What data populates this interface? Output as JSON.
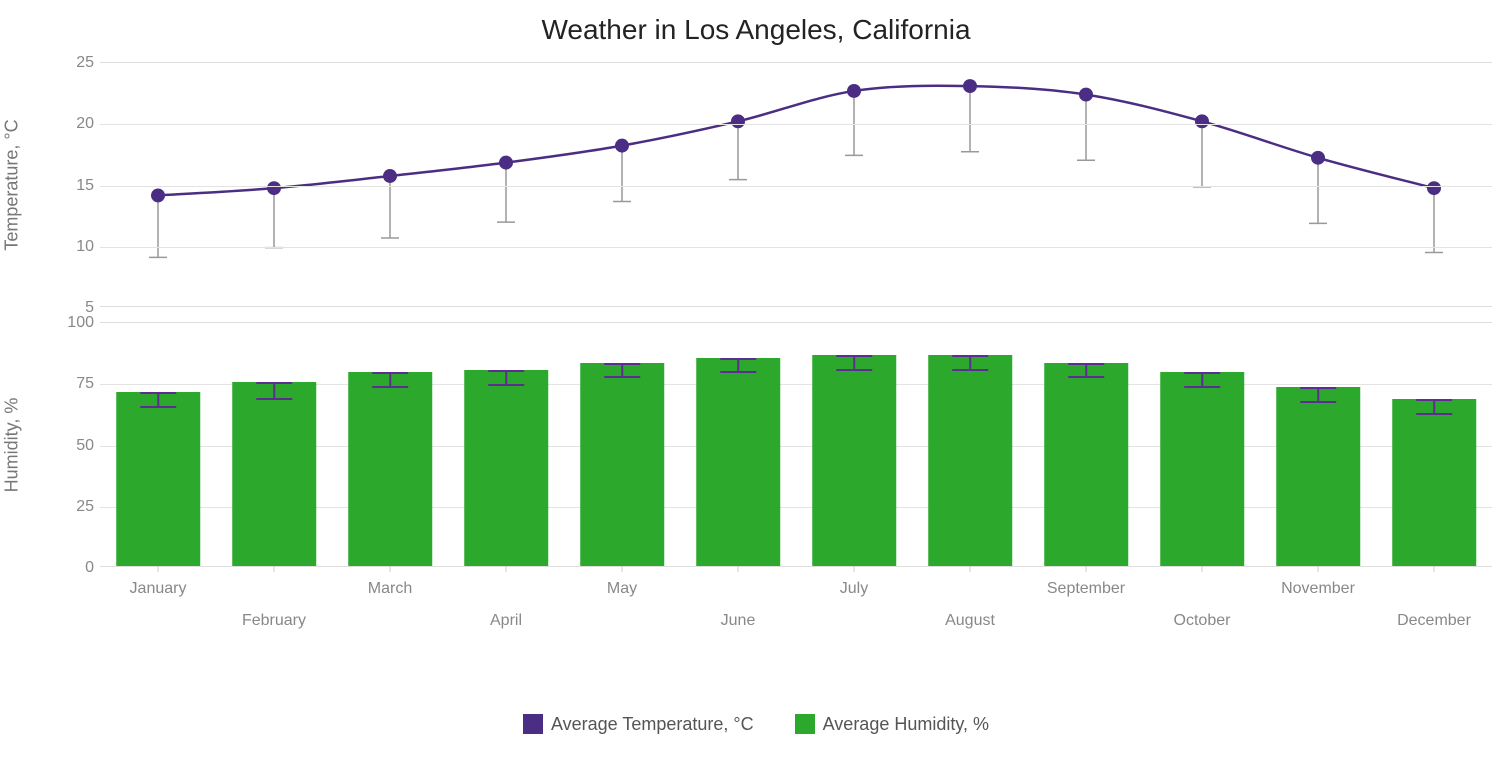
{
  "title": "Weather in Los Angeles, California",
  "legend": {
    "temp": "Average Temperature, °C",
    "humid": "Average Humidity, %"
  },
  "axes": {
    "temp": {
      "label": "Temperature, °C",
      "min": 5,
      "max": 25,
      "ticks": [
        5,
        10,
        15,
        20,
        25
      ]
    },
    "humid": {
      "label": "Humidity, %",
      "min": 0,
      "max": 100,
      "ticks": [
        0,
        25,
        50,
        75,
        100
      ]
    }
  },
  "categories": [
    "January",
    "February",
    "March",
    "April",
    "May",
    "June",
    "July",
    "August",
    "September",
    "October",
    "November",
    "December"
  ],
  "colors": {
    "temp": "#4b2e83",
    "humid": "#2ca92c",
    "humid_err": "#5e2d91",
    "temp_err": "#999999"
  },
  "chart_data": [
    {
      "type": "line",
      "name": "Average Temperature, °C",
      "ylabel": "Temperature, °C",
      "ylim": [
        5,
        25
      ],
      "categories": [
        "January",
        "February",
        "March",
        "April",
        "May",
        "June",
        "July",
        "August",
        "September",
        "October",
        "November",
        "December"
      ],
      "values": [
        14.1,
        14.7,
        15.7,
        16.8,
        18.2,
        20.2,
        22.7,
        23.1,
        22.4,
        20.2,
        17.2,
        14.7
      ],
      "error_low": [
        9.0,
        9.8,
        10.6,
        11.9,
        13.6,
        15.4,
        17.4,
        17.7,
        17.0,
        14.8,
        11.8,
        9.4
      ]
    },
    {
      "type": "bar",
      "name": "Average Humidity, %",
      "ylabel": "Humidity, %",
      "ylim": [
        0,
        100
      ],
      "categories": [
        "January",
        "February",
        "March",
        "April",
        "May",
        "June",
        "July",
        "August",
        "September",
        "October",
        "November",
        "December"
      ],
      "values": [
        71,
        75,
        79,
        80,
        83,
        85,
        86,
        86,
        83,
        79,
        73,
        68
      ],
      "error_low": [
        65,
        68,
        73,
        74,
        77,
        79,
        80,
        80,
        77,
        73,
        67,
        62
      ]
    }
  ]
}
